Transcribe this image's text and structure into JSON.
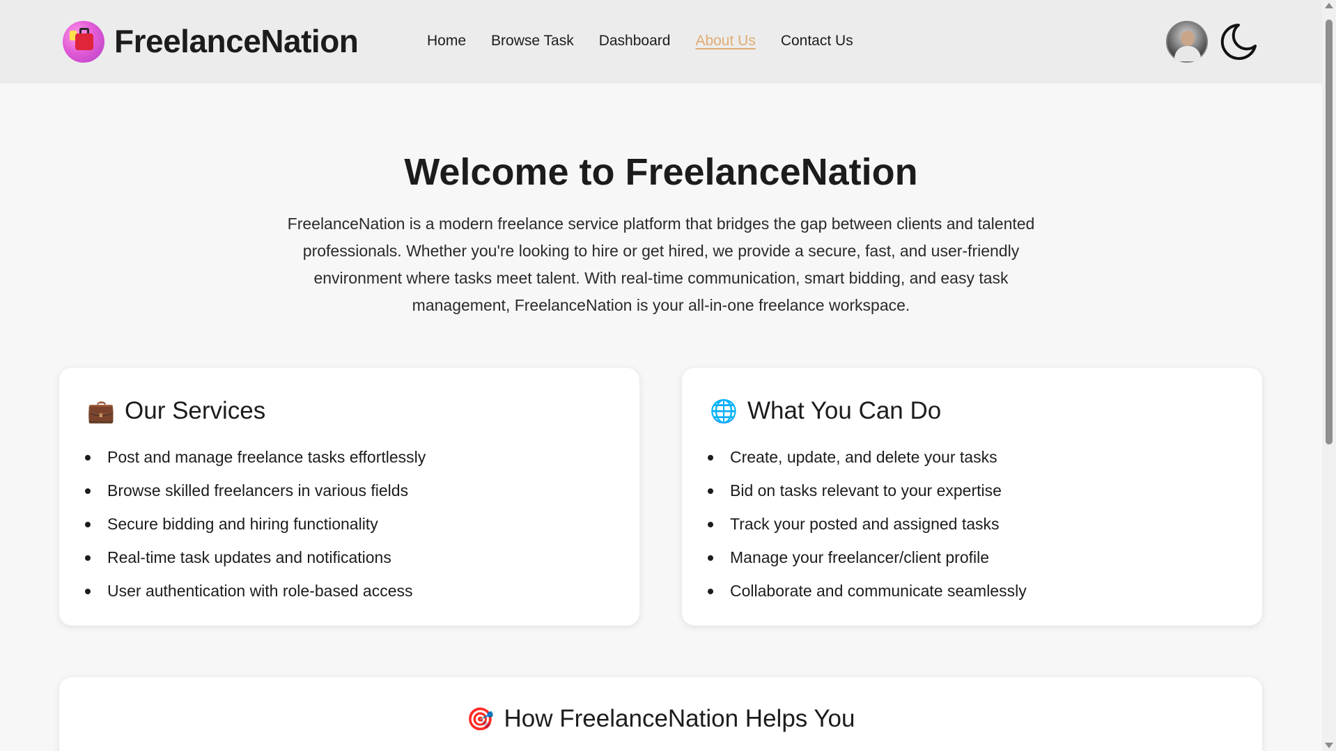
{
  "header": {
    "brand": "FreelanceNation",
    "nav": [
      "Home",
      "Browse Task",
      "Dashboard",
      "About Us",
      "Contact Us"
    ],
    "active_nav": "About Us"
  },
  "hero": {
    "title": "Welcome to FreelanceNation",
    "description": "FreelanceNation is a modern freelance service platform that bridges the gap between clients and talented professionals. Whether you're looking to hire or get hired, we provide a secure, fast, and user-friendly environment where tasks meet talent. With real-time communication, smart bidding, and easy task management, FreelanceNation is your all-in-one freelance workspace."
  },
  "services": {
    "icon": "briefcase-icon",
    "title": "Our Services",
    "items": [
      "Post and manage freelance tasks effortlessly",
      "Browse skilled freelancers in various fields",
      "Secure bidding and hiring functionality",
      "Real-time task updates and notifications",
      "User authentication with role-based access"
    ]
  },
  "what_you_can_do": {
    "icon": "globe-icon",
    "title": "What You Can Do",
    "items": [
      "Create, update, and delete your tasks",
      "Bid on tasks relevant to your expertise",
      "Track your posted and assigned tasks",
      "Manage your freelancer/client profile",
      "Collaborate and communicate seamlessly"
    ]
  },
  "helps": {
    "icon": "target-icon",
    "title": "How FreelanceNation Helps You"
  },
  "colors": {
    "active_link": "#e0ac72",
    "header_bg": "#ececec",
    "page_bg": "#f7f7f7"
  }
}
